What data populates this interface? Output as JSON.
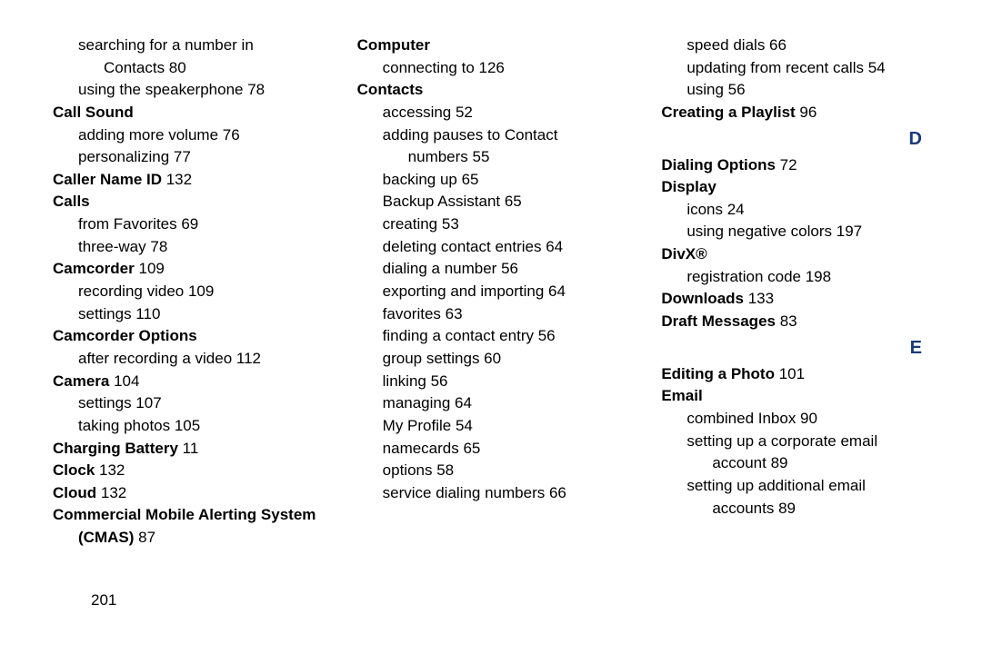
{
  "page_number": "201",
  "letters": {
    "D": "D",
    "E": "E"
  },
  "col1": [
    {
      "type": "sub2",
      "text": "searching for a number in "
    },
    {
      "type": "sub3",
      "text": "Contacts",
      "pg": " 80"
    },
    {
      "type": "sub2",
      "text": "using the speakerphone",
      "pg": " 78"
    },
    {
      "type": "term",
      "text": "Call Sound"
    },
    {
      "type": "sub2",
      "text": "adding more volume",
      "pg": " 76"
    },
    {
      "type": "sub2",
      "text": "personalizing",
      "pg": " 77"
    },
    {
      "type": "term",
      "text": "Caller Name ID",
      "pg": " 132"
    },
    {
      "type": "term",
      "text": "Calls"
    },
    {
      "type": "sub2",
      "text": "from Favorites",
      "pg": " 69"
    },
    {
      "type": "sub2",
      "text": "three-way",
      "pg": " 78"
    },
    {
      "type": "term",
      "text": "Camcorder",
      "pg": " 109"
    },
    {
      "type": "sub2",
      "text": "recording video",
      "pg": " 109"
    },
    {
      "type": "sub2",
      "text": "settings",
      "pg": " 110"
    },
    {
      "type": "term",
      "text": "Camcorder Options"
    },
    {
      "type": "sub2",
      "text": "after recording a video",
      "pg": " 112"
    },
    {
      "type": "term",
      "text": "Camera",
      "pg": " 104"
    },
    {
      "type": "sub2",
      "text": "settings",
      "pg": " 107"
    },
    {
      "type": "sub2",
      "text": "taking photos",
      "pg": " 105"
    },
    {
      "type": "term",
      "text": "Charging Battery",
      "pg": " 11"
    },
    {
      "type": "term",
      "text": "Clock",
      "pg": " 132"
    },
    {
      "type": "term",
      "text": "Cloud",
      "pg": " 132"
    },
    {
      "type": "term",
      "text": "Commercial Mobile Alerting System "
    },
    {
      "type": "sub2b",
      "text": "(CMAS)",
      "pg": " 87"
    }
  ],
  "col2": [
    {
      "type": "term",
      "text": "Computer"
    },
    {
      "type": "sub2",
      "text": "connecting to",
      "pg": " 126"
    },
    {
      "type": "term",
      "text": "Contacts"
    },
    {
      "type": "sub2",
      "text": "accessing",
      "pg": " 52"
    },
    {
      "type": "sub2",
      "text": "adding pauses to Contact "
    },
    {
      "type": "sub3",
      "text": "numbers",
      "pg": " 55"
    },
    {
      "type": "sub2",
      "text": "backing up",
      "pg": " 65"
    },
    {
      "type": "sub2",
      "text": "Backup Assistant",
      "pg": " 65"
    },
    {
      "type": "sub2",
      "text": "creating",
      "pg": " 53"
    },
    {
      "type": "sub2",
      "text": "deleting contact entries",
      "pg": " 64"
    },
    {
      "type": "sub2",
      "text": "dialing a number",
      "pg": " 56"
    },
    {
      "type": "sub2",
      "text": "exporting and importing",
      "pg": " 64"
    },
    {
      "type": "sub2",
      "text": "favorites",
      "pg": " 63"
    },
    {
      "type": "sub2",
      "text": "finding a contact entry",
      "pg": " 56"
    },
    {
      "type": "sub2",
      "text": "group settings",
      "pg": " 60"
    },
    {
      "type": "sub2",
      "text": "linking",
      "pg": " 56"
    },
    {
      "type": "sub2",
      "text": "managing",
      "pg": " 64"
    },
    {
      "type": "sub2",
      "text": "My Profile",
      "pg": " 54"
    },
    {
      "type": "sub2",
      "text": "namecards",
      "pg": " 65"
    },
    {
      "type": "sub2",
      "text": "options",
      "pg": " 58"
    },
    {
      "type": "sub2",
      "text": "service dialing numbers",
      "pg": " 66"
    }
  ],
  "col3a": [
    {
      "type": "sub2",
      "text": "speed dials",
      "pg": " 66"
    },
    {
      "type": "sub2",
      "text": "updating from recent calls",
      "pg": " 54"
    },
    {
      "type": "sub2",
      "text": "using",
      "pg": " 56"
    },
    {
      "type": "term",
      "text": "Creating a Playlist",
      "pg": " 96"
    }
  ],
  "col3b": [
    {
      "type": "term",
      "text": "Dialing Options",
      "pg": " 72"
    },
    {
      "type": "term",
      "text": "Display"
    },
    {
      "type": "sub2",
      "text": "icons",
      "pg": " 24"
    },
    {
      "type": "sub2",
      "text": "using negative colors",
      "pg": " 197"
    },
    {
      "type": "term",
      "text": "DivX®"
    },
    {
      "type": "sub2",
      "text": "registration code",
      "pg": " 198"
    },
    {
      "type": "term",
      "text": "Downloads",
      "pg": " 133"
    },
    {
      "type": "term",
      "text": "Draft Messages",
      "pg": " 83"
    }
  ],
  "col3c": [
    {
      "type": "term",
      "text": "Editing a Photo",
      "pg": " 101"
    },
    {
      "type": "term",
      "text": "Email"
    },
    {
      "type": "sub2",
      "text": "combined Inbox",
      "pg": " 90"
    },
    {
      "type": "sub2",
      "text": "setting up a corporate email "
    },
    {
      "type": "sub3",
      "text": "account",
      "pg": " 89"
    },
    {
      "type": "sub2",
      "text": "setting up additional email "
    },
    {
      "type": "sub3",
      "text": "accounts",
      "pg": " 89"
    }
  ]
}
